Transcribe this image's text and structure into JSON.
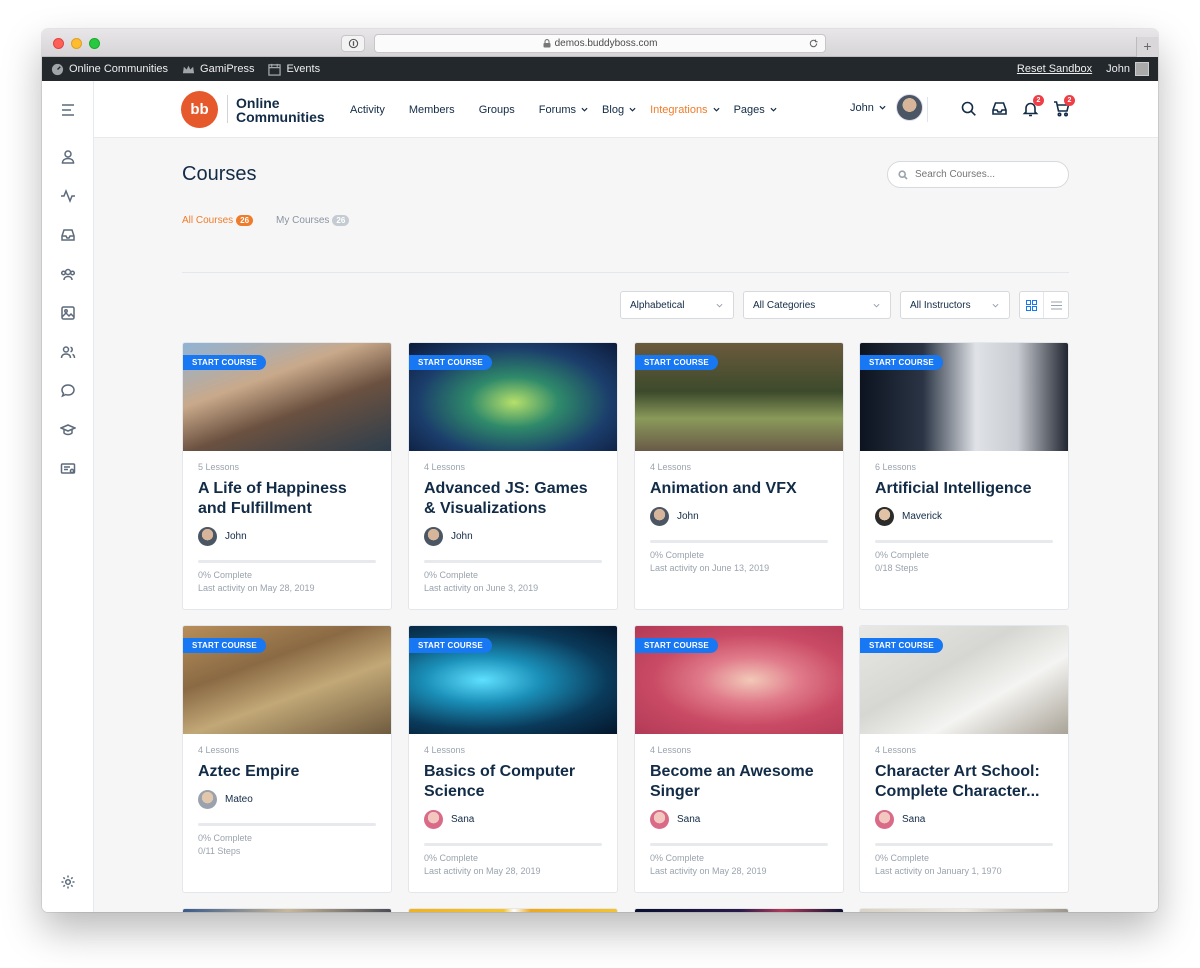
{
  "browser": {
    "url": "demos.buddyboss.com",
    "new_tab": "+"
  },
  "adminbar": {
    "items": [
      "Online Communities",
      "GamiPress",
      "Events"
    ],
    "reset": "Reset Sandbox",
    "user": "John"
  },
  "header": {
    "logo_text": "bb",
    "brand": [
      "Online",
      "Communities"
    ],
    "nav": [
      "Activity",
      "Members",
      "Groups",
      "Forums",
      "Blog",
      "Integrations",
      "Pages"
    ],
    "user_name": "John",
    "notifications_count": "2",
    "cart_count": "2"
  },
  "page": {
    "title": "Courses",
    "search_placeholder": "Search Courses...",
    "tabs": [
      {
        "label": "All Courses",
        "count": "26"
      },
      {
        "label": "My Courses",
        "count": "26"
      }
    ],
    "filters": [
      "Alphabetical",
      "All Categories",
      "All Instructors"
    ]
  },
  "start_label": "START COURSE",
  "courses": [
    {
      "lessons": "5 Lessons",
      "title": "A Life of Happiness and Fulfillment",
      "author": "John",
      "complete": "0% Complete",
      "detail": "Last activity on May 28, 2019"
    },
    {
      "lessons": "4 Lessons",
      "title": "Advanced JS: Games & Visualizations",
      "author": "John",
      "complete": "0% Complete",
      "detail": "Last activity on June 3, 2019"
    },
    {
      "lessons": "4 Lessons",
      "title": "Animation and VFX",
      "author": "John",
      "complete": "0% Complete",
      "detail": "Last activity on June 13, 2019"
    },
    {
      "lessons": "6 Lessons",
      "title": "Artificial Intelligence",
      "author": "Maverick",
      "complete": "0% Complete",
      "detail": "0/18 Steps"
    },
    {
      "lessons": "4 Lessons",
      "title": "Aztec Empire",
      "author": "Mateo",
      "complete": "0% Complete",
      "detail": "0/11 Steps"
    },
    {
      "lessons": "4 Lessons",
      "title": "Basics of Computer Science",
      "author": "Sana",
      "complete": "0% Complete",
      "detail": "Last activity on May 28, 2019"
    },
    {
      "lessons": "4 Lessons",
      "title": "Become an Awesome Singer",
      "author": "Sana",
      "complete": "0% Complete",
      "detail": "Last activity on May 28, 2019"
    },
    {
      "lessons": "4 Lessons",
      "title": "Character Art School: Complete Character...",
      "author": "Sana",
      "complete": "0% Complete",
      "detail": "Last activity on January 1, 1970"
    }
  ]
}
